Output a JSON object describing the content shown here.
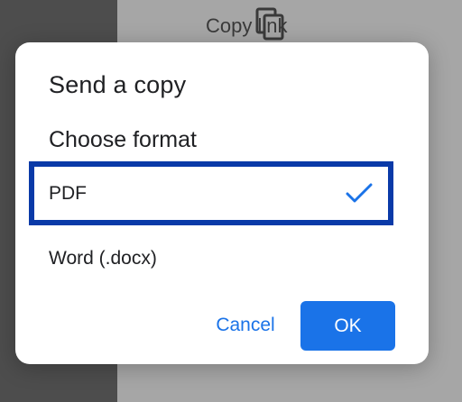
{
  "background_menu": {
    "icon": "copy-icon",
    "label": "Copy link"
  },
  "dialog": {
    "title": "Send a copy",
    "section_label": "Choose format",
    "options": [
      {
        "label": "PDF",
        "selected": true
      },
      {
        "label": "Word (.docx)",
        "selected": false
      }
    ],
    "cancel_label": "Cancel",
    "ok_label": "OK"
  },
  "colors": {
    "accent": "#1a73e8",
    "highlight_border": "#0a3aa8",
    "dialog_bg": "#ffffff",
    "scrim_left": "#4d4d4d",
    "scrim_right": "#a6a6a6"
  }
}
